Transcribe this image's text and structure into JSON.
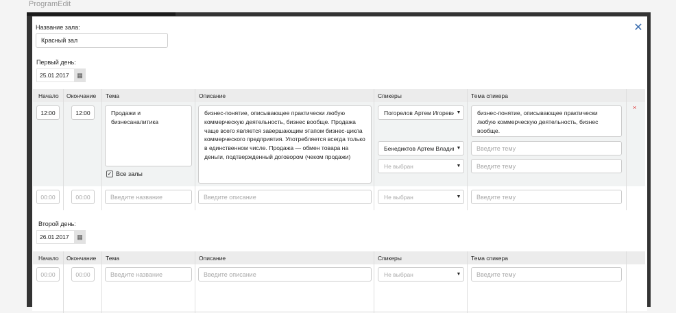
{
  "window": {
    "title": "ProgramEdit"
  },
  "form": {
    "hall_label": "Название зала:",
    "hall_value": "Красный зал"
  },
  "columns": {
    "start": "Начало",
    "end": "Окончание",
    "topic": "Тема",
    "description": "Описание",
    "speakers": "Спикеры",
    "speaker_topic": "Тема спикера"
  },
  "placeholders": {
    "time": "00:00",
    "topic": "Введите название",
    "description": "Введите описание",
    "speaker": "Не выбран",
    "speaker_topic": "Введите тему"
  },
  "days": [
    {
      "label": "Первый день:",
      "date": "25.01.2017",
      "session": {
        "start": "12:00",
        "end": "12:00",
        "topic": "Продажи и бизнесаналитика",
        "all_halls_label": "Все залы",
        "all_halls_checked": true,
        "description": "бизнес-понятие, описывающее практически любую коммерческую деятельность, бизнес вообще. Продажа чаще всего является завершающим этапом бизнес-цикла коммерческого предприятия. Употребляется всегда только в единственном числе. Продажа — обмен товара на деньги, подтвержденный договором (чеком продажи)",
        "speakers": [
          {
            "name": "Погорелов Артем Игоревич",
            "topic": "бизнес-понятие, описывающее практически любую коммерческую деятельность, бизнес вообще."
          },
          {
            "name": "Бенедиктов Артем Владимирович",
            "topic": ""
          }
        ],
        "delete_icon": "×"
      }
    },
    {
      "label": "Второй день:",
      "date": "26.01.2017"
    }
  ],
  "icons": {
    "close": "close-icon",
    "calendar": "calendar-icon",
    "dropdown": "chevron-down-icon",
    "delete": "delete-icon"
  },
  "colors": {
    "close_icon": "#3d6fb0",
    "delete_icon": "#dd3333",
    "header_bg": "#ececec",
    "band_bg": "#f1f3f3"
  }
}
